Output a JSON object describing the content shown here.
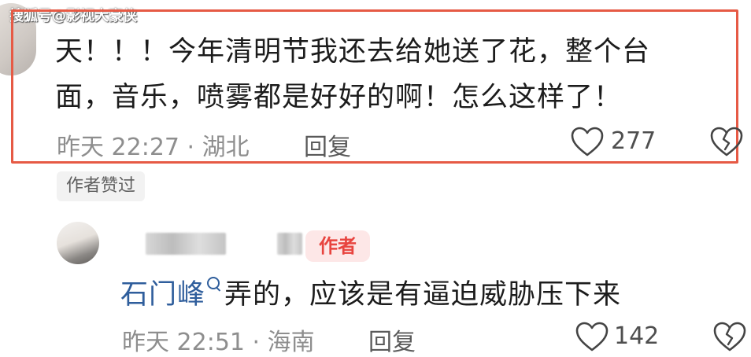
{
  "watermark": "搜狐号@影视大豪侠",
  "comment": {
    "line1": "天！！！今年清明节我还去给她送了花，整个台",
    "line2": "面，音乐，喷雾都是好好的啊！怎么这样了！",
    "time_location": "昨天 22:27 · 湖北",
    "reply_label": "回复",
    "likes": "277"
  },
  "liked_by_author_badge": "作者赞过",
  "reply": {
    "author_tag": "作者",
    "name": "石门峰",
    "text": "弄的，应该是有逼迫威胁压下来",
    "time_location": "昨天 22:51 · 海南",
    "reply_label": "回复",
    "likes": "142"
  },
  "icons": [
    "heart-outline-icon",
    "broken-heart-icon",
    "search-mini-icon"
  ],
  "colors": {
    "highlight": "#e65a45",
    "author_tag_text": "#e8443f",
    "name_link": "#2f5e9c"
  }
}
